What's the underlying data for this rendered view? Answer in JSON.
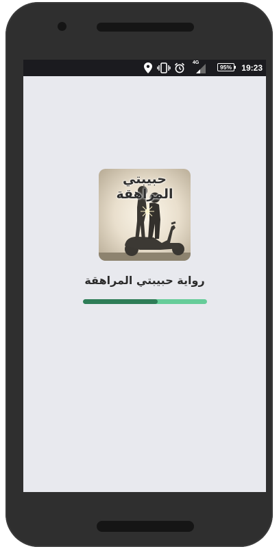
{
  "status_bar": {
    "time": "19:23",
    "battery_label": "95%",
    "network_label": "4G",
    "icons": [
      "location-icon",
      "vibrate-icon",
      "alarm-icon",
      "signal-icon",
      "battery-icon"
    ]
  },
  "app": {
    "icon_text": "حبيبتي المراهقة",
    "name": "رواية حبيبتي المراهقة",
    "loading_progress": 0.6,
    "colors": {
      "screen_bg": "#e8e9ee",
      "progress_fill": "#2e7d57",
      "progress_track": "#66cc99"
    }
  }
}
